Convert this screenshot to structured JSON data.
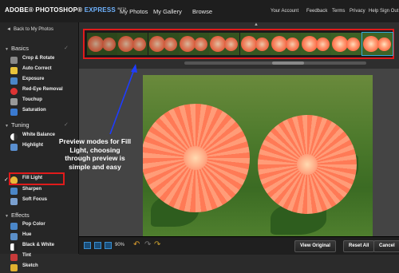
{
  "header": {
    "logo_main": "ADOBE® PHOTOSHOP®",
    "logo_express": "EXPRESS",
    "logo_badge": "BETA",
    "nav": [
      "My Photos",
      "My Gallery",
      "Browse"
    ],
    "right_links": [
      "Your Account",
      "Feedback",
      "Terms",
      "Privacy",
      "Help",
      "Sign Out"
    ]
  },
  "sidebar": {
    "back_label": "Back to My Photos",
    "sections": [
      {
        "title": "Basics",
        "tools": [
          "Crop & Rotate",
          "Auto Correct",
          "Exposure",
          "Red-Eye Removal",
          "Touchup",
          "Saturation"
        ]
      },
      {
        "title": "Tuning",
        "tools": [
          "White Balance",
          "Highlight",
          "Fill Light",
          "Sharpen",
          "Soft Focus"
        ]
      },
      {
        "title": "Effects",
        "tools": [
          "Pop Color",
          "Hue",
          "Black & White",
          "Tint",
          "Sketch"
        ]
      }
    ],
    "selected_tool": "Fill Light"
  },
  "annotation": "Preview modes for Fill Light, choosing through preview is simple and easy",
  "bottombar": {
    "zoom": "90%",
    "view_original": "View Original",
    "reset_all": "Reset All",
    "cancel": "Cancel"
  },
  "colors": {
    "highlight_red": "#e01b1b",
    "annotation_arrow": "#1e3cff",
    "accent_blue": "#2f9fd0"
  }
}
